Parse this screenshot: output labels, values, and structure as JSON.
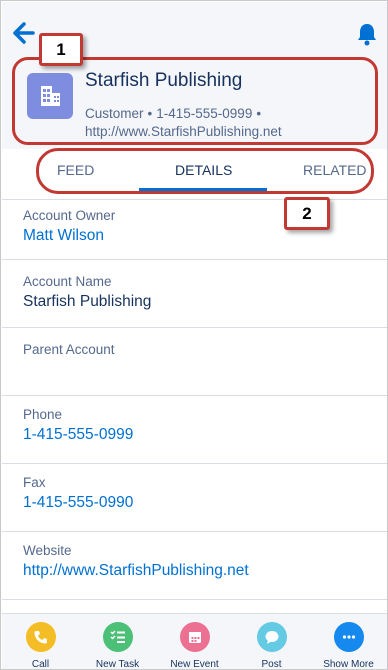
{
  "header": {
    "account_name": "Starfish Publishing",
    "meta_type": "Customer",
    "meta_phone": "1-415-555-0999",
    "meta_website": "http://www.StarfishPublishing.net",
    "separator": "•"
  },
  "callouts": {
    "one": "1",
    "two": "2"
  },
  "tabs": [
    {
      "label": "FEED"
    },
    {
      "label": "DETAILS"
    },
    {
      "label": "RELATED"
    }
  ],
  "active_tab": "DETAILS",
  "fields": [
    {
      "label": "Account Owner",
      "value": "Matt Wilson"
    },
    {
      "label": "Account Name",
      "value": "Starfish Publishing"
    },
    {
      "label": "Parent Account",
      "value": ""
    },
    {
      "label": "Phone",
      "value": "1-415-555-0999"
    },
    {
      "label": "Fax",
      "value": "1-415-555-0990"
    },
    {
      "label": "Website",
      "value": "http://www.StarfishPublishing.net"
    }
  ],
  "actions": [
    {
      "label": "Call",
      "icon": "phone-icon",
      "color": "#f4bc25"
    },
    {
      "label": "New Task",
      "icon": "task-list-icon",
      "color": "#4bc076"
    },
    {
      "label": "New Event",
      "icon": "calendar-icon",
      "color": "#eb7092"
    },
    {
      "label": "Post",
      "icon": "chat-bubble-icon",
      "color": "#65cae4"
    },
    {
      "label": "Show More",
      "icon": "more-dots-icon",
      "color": "#1589ee"
    }
  ],
  "colors": {
    "brand_blue": "#0070d2",
    "account_icon": "#7f8de1",
    "callout_red": "#c23934"
  }
}
